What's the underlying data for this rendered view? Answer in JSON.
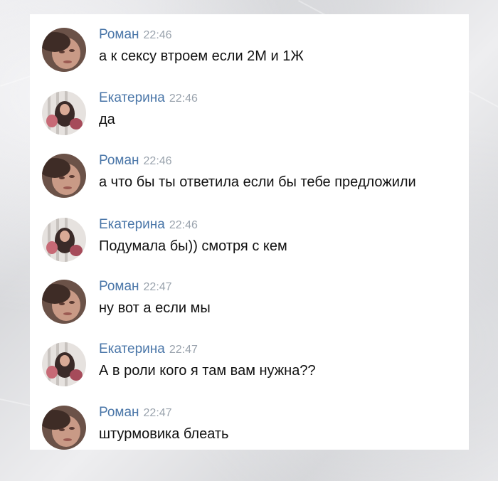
{
  "messages": [
    {
      "author": "Роман",
      "time": "22:46",
      "text": "а к сексу втроем если 2М и 1Ж",
      "avatar": "roman-avatar"
    },
    {
      "author": "Екатерина",
      "time": "22:46",
      "text": "да",
      "avatar": "ekaterina-avatar"
    },
    {
      "author": "Роман",
      "time": "22:46",
      "text": "а что бы ты ответила если бы тебе предложили",
      "avatar": "roman-avatar"
    },
    {
      "author": "Екатерина",
      "time": "22:46",
      "text": "Подумала бы)) смотря с кем",
      "avatar": "ekaterina-avatar"
    },
    {
      "author": "Роман",
      "time": "22:47",
      "text": "ну вот а если мы",
      "avatar": "roman-avatar"
    },
    {
      "author": "Екатерина",
      "time": "22:47",
      "text": "А в роли кого я там вам нужна??",
      "avatar": "ekaterina-avatar"
    },
    {
      "author": "Роман",
      "time": "22:47",
      "text": "штурмовика блеать",
      "avatar": "roman-avatar"
    }
  ],
  "colors": {
    "author_link": "#4a76a8",
    "timestamp": "#9aa3ad",
    "message_text": "#111111",
    "card_background": "#ffffff"
  }
}
